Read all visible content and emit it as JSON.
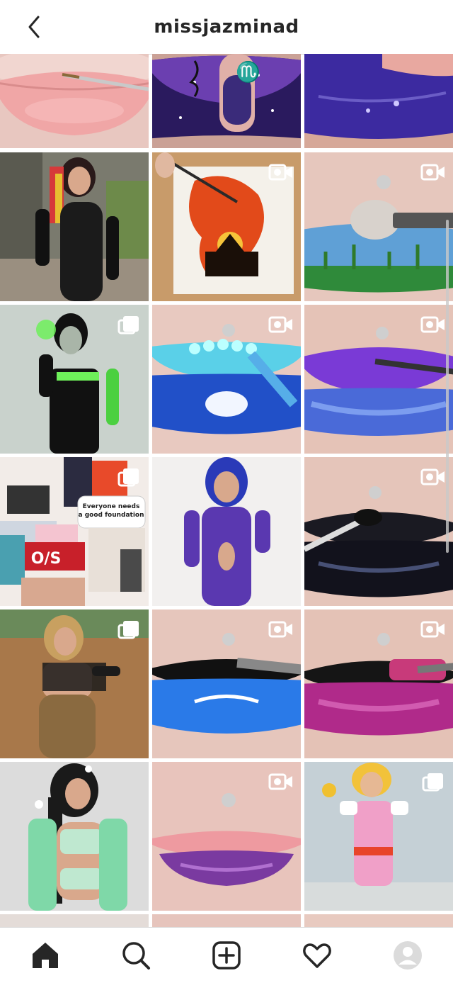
{
  "header": {
    "title": "missjazminad",
    "back_icon": "chevron-left-icon"
  },
  "grid": {
    "rows": [
      [
        {
          "subject": "pink lips",
          "badge": "none"
        },
        {
          "subject": "scorpio galaxy lips",
          "badge": "none"
        },
        {
          "subject": "purple lips",
          "badge": "none"
        }
      ],
      [
        {
          "subject": "woman in black latex",
          "badge": "none"
        },
        {
          "subject": "sunset painting",
          "badge": "video"
        },
        {
          "subject": "landscape lips",
          "badge": "video"
        }
      ],
      [
        {
          "subject": "villain cosplay",
          "badge": "carousel"
        },
        {
          "subject": "blue mermaid lips",
          "badge": "video"
        },
        {
          "subject": "holographic lips",
          "badge": "video"
        }
      ],
      [
        {
          "subject": "makeup products flat lay",
          "badge": "carousel"
        },
        {
          "subject": "woman in blue lace",
          "badge": "none"
        },
        {
          "subject": "black glitter lips",
          "badge": "video"
        }
      ],
      [
        {
          "subject": "woman in black top",
          "badge": "carousel"
        },
        {
          "subject": "blue glossy lips",
          "badge": "video"
        },
        {
          "subject": "pink metallic lips",
          "badge": "video"
        }
      ],
      [
        {
          "subject": "woman in mint lingerie",
          "badge": "none"
        },
        {
          "subject": "violet lips",
          "badge": "video"
        },
        {
          "subject": "cartoon cosplay",
          "badge": "carousel"
        }
      ]
    ],
    "product_text_1": "Everyone needs",
    "product_text_2": "a good foundation",
    "product_logo": "O/S"
  },
  "bottom_nav": {
    "items": [
      "home-icon",
      "search-icon",
      "new-post-icon",
      "activity-icon",
      "profile-icon"
    ]
  },
  "colors": {
    "text": "#262626",
    "border": "#dbdbdb"
  }
}
